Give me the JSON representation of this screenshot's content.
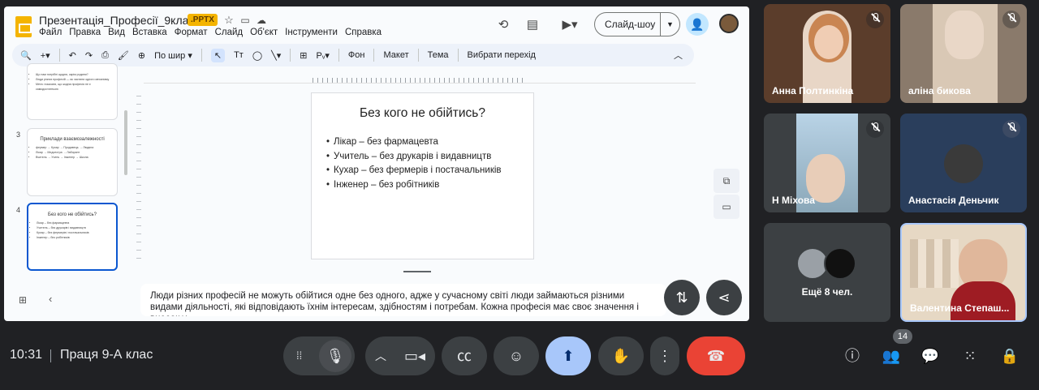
{
  "slides_app": {
    "doc_title": "Презентація_Професії_9клас",
    "file_badge": ".PPTX",
    "menu": [
      "Файл",
      "Правка",
      "Вид",
      "Вставка",
      "Формат",
      "Слайд",
      "Об'єкт",
      "Інструменти",
      "Справка"
    ],
    "slideshow_label": "Слайд-шоу",
    "toolbar": {
      "zoom_label": "По шир",
      "background": "Фон",
      "layout": "Макет",
      "theme": "Тема",
      "transition": "Вибрати перехід"
    },
    "filmstrip": [
      {
        "number": "",
        "title": "",
        "bullets": [
          "Що нам потрібні щодня, окрім родини?",
          "Люди різних професій — як частини одного механізму",
          "Мета: показати, що жодна професія не є самодостатньою"
        ]
      },
      {
        "number": "3",
        "title": "Приклади взаємозалежності",
        "bullets": [
          "фермер → Кухар → Продавець → Людина",
          "Лікар → Медсестра → Лаборант",
          "Вчитель → Учень → Інженер → Школа"
        ]
      },
      {
        "number": "4",
        "title": "Без кого не обійтись?",
        "bullets": [
          "Лікар – без фармацевта",
          "Учитель – без друкарів і видавництв",
          "Кухар – без фермерів і постачальників",
          "Інженер – без робітників"
        ]
      }
    ],
    "current_slide": {
      "title": "Без кого не обійтись?",
      "bullets": [
        "Лікар – без фармацевта",
        "Учитель – без друкарів і видавництв",
        "Кухар – без фермерів і постачальників",
        "Інженер – без робітників"
      ]
    },
    "speaker_notes": "Люди різних професій не можуть обійтися одне без одного, адже у сучасному світі люди займаються різними видами діяльності, які відповідають їхнім інтересам, здібностям і потребам. Кожна професія має своє значення і внесок у"
  },
  "participants": [
    {
      "name": "Анна Полтинкіна",
      "muted": true
    },
    {
      "name": "аліна бикова",
      "muted": true
    },
    {
      "name": "Н Міхова",
      "muted": true
    },
    {
      "name": "Анастасія Деньчик",
      "muted": true
    },
    {
      "name": "Ещё 8 чел."
    },
    {
      "name": "Валентина Степаш..."
    }
  ],
  "meeting_bar": {
    "time": "10:31",
    "meeting_name": "Праця 9-А клас",
    "participant_count": "14"
  },
  "colors": {
    "accent": "#0b57d0",
    "end_call": "#ea4335",
    "present_active": "#a8c7fa",
    "slides_yellow": "#f4b400"
  }
}
